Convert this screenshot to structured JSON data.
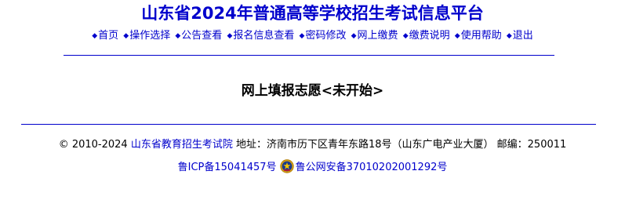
{
  "header": {
    "title": "山东省2024年普通高等学校招生考试信息平台"
  },
  "nav": {
    "bullet": "◆",
    "items": [
      {
        "label": "首页"
      },
      {
        "label": "操作选择"
      },
      {
        "label": "公告查看"
      },
      {
        "label": "报名信息查看"
      },
      {
        "label": "密码修改"
      },
      {
        "label": "网上缴费"
      },
      {
        "label": "缴费说明"
      },
      {
        "label": "使用帮助"
      },
      {
        "label": "退出"
      }
    ]
  },
  "main": {
    "status": "网上填报志愿<未开始>"
  },
  "footer": {
    "copyright": "© 2010-2024 ",
    "institution_link": "山东省教育招生考试院",
    "address": " 地址：济南市历下区青年东路18号（山东广电产业大厦） 邮编：250011",
    "icp_link": "鲁ICP备15041457号",
    "police_link": "鲁公网安备37010202001292号",
    "police_icon": "police-badge-icon"
  },
  "colors": {
    "link": "#0000cc",
    "rule": "#0000cc",
    "text": "#000000"
  }
}
